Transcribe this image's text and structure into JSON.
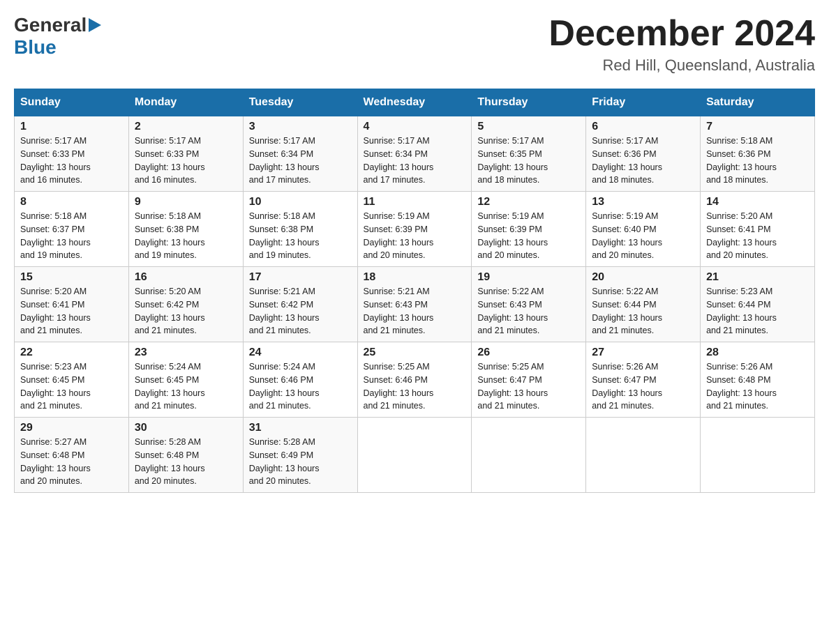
{
  "header": {
    "month_year": "December 2024",
    "location": "Red Hill, Queensland, Australia",
    "logo_general": "General",
    "logo_blue": "Blue"
  },
  "days_of_week": [
    "Sunday",
    "Monday",
    "Tuesday",
    "Wednesday",
    "Thursday",
    "Friday",
    "Saturday"
  ],
  "weeks": [
    [
      {
        "day": "1",
        "sunrise": "5:17 AM",
        "sunset": "6:33 PM",
        "daylight": "13 hours and 16 minutes."
      },
      {
        "day": "2",
        "sunrise": "5:17 AM",
        "sunset": "6:33 PM",
        "daylight": "13 hours and 16 minutes."
      },
      {
        "day": "3",
        "sunrise": "5:17 AM",
        "sunset": "6:34 PM",
        "daylight": "13 hours and 17 minutes."
      },
      {
        "day": "4",
        "sunrise": "5:17 AM",
        "sunset": "6:34 PM",
        "daylight": "13 hours and 17 minutes."
      },
      {
        "day": "5",
        "sunrise": "5:17 AM",
        "sunset": "6:35 PM",
        "daylight": "13 hours and 18 minutes."
      },
      {
        "day": "6",
        "sunrise": "5:17 AM",
        "sunset": "6:36 PM",
        "daylight": "13 hours and 18 minutes."
      },
      {
        "day": "7",
        "sunrise": "5:18 AM",
        "sunset": "6:36 PM",
        "daylight": "13 hours and 18 minutes."
      }
    ],
    [
      {
        "day": "8",
        "sunrise": "5:18 AM",
        "sunset": "6:37 PM",
        "daylight": "13 hours and 19 minutes."
      },
      {
        "day": "9",
        "sunrise": "5:18 AM",
        "sunset": "6:38 PM",
        "daylight": "13 hours and 19 minutes."
      },
      {
        "day": "10",
        "sunrise": "5:18 AM",
        "sunset": "6:38 PM",
        "daylight": "13 hours and 19 minutes."
      },
      {
        "day": "11",
        "sunrise": "5:19 AM",
        "sunset": "6:39 PM",
        "daylight": "13 hours and 20 minutes."
      },
      {
        "day": "12",
        "sunrise": "5:19 AM",
        "sunset": "6:39 PM",
        "daylight": "13 hours and 20 minutes."
      },
      {
        "day": "13",
        "sunrise": "5:19 AM",
        "sunset": "6:40 PM",
        "daylight": "13 hours and 20 minutes."
      },
      {
        "day": "14",
        "sunrise": "5:20 AM",
        "sunset": "6:41 PM",
        "daylight": "13 hours and 20 minutes."
      }
    ],
    [
      {
        "day": "15",
        "sunrise": "5:20 AM",
        "sunset": "6:41 PM",
        "daylight": "13 hours and 21 minutes."
      },
      {
        "day": "16",
        "sunrise": "5:20 AM",
        "sunset": "6:42 PM",
        "daylight": "13 hours and 21 minutes."
      },
      {
        "day": "17",
        "sunrise": "5:21 AM",
        "sunset": "6:42 PM",
        "daylight": "13 hours and 21 minutes."
      },
      {
        "day": "18",
        "sunrise": "5:21 AM",
        "sunset": "6:43 PM",
        "daylight": "13 hours and 21 minutes."
      },
      {
        "day": "19",
        "sunrise": "5:22 AM",
        "sunset": "6:43 PM",
        "daylight": "13 hours and 21 minutes."
      },
      {
        "day": "20",
        "sunrise": "5:22 AM",
        "sunset": "6:44 PM",
        "daylight": "13 hours and 21 minutes."
      },
      {
        "day": "21",
        "sunrise": "5:23 AM",
        "sunset": "6:44 PM",
        "daylight": "13 hours and 21 minutes."
      }
    ],
    [
      {
        "day": "22",
        "sunrise": "5:23 AM",
        "sunset": "6:45 PM",
        "daylight": "13 hours and 21 minutes."
      },
      {
        "day": "23",
        "sunrise": "5:24 AM",
        "sunset": "6:45 PM",
        "daylight": "13 hours and 21 minutes."
      },
      {
        "day": "24",
        "sunrise": "5:24 AM",
        "sunset": "6:46 PM",
        "daylight": "13 hours and 21 minutes."
      },
      {
        "day": "25",
        "sunrise": "5:25 AM",
        "sunset": "6:46 PM",
        "daylight": "13 hours and 21 minutes."
      },
      {
        "day": "26",
        "sunrise": "5:25 AM",
        "sunset": "6:47 PM",
        "daylight": "13 hours and 21 minutes."
      },
      {
        "day": "27",
        "sunrise": "5:26 AM",
        "sunset": "6:47 PM",
        "daylight": "13 hours and 21 minutes."
      },
      {
        "day": "28",
        "sunrise": "5:26 AM",
        "sunset": "6:48 PM",
        "daylight": "13 hours and 21 minutes."
      }
    ],
    [
      {
        "day": "29",
        "sunrise": "5:27 AM",
        "sunset": "6:48 PM",
        "daylight": "13 hours and 20 minutes."
      },
      {
        "day": "30",
        "sunrise": "5:28 AM",
        "sunset": "6:48 PM",
        "daylight": "13 hours and 20 minutes."
      },
      {
        "day": "31",
        "sunrise": "5:28 AM",
        "sunset": "6:49 PM",
        "daylight": "13 hours and 20 minutes."
      },
      null,
      null,
      null,
      null
    ]
  ],
  "labels": {
    "sunrise": "Sunrise:",
    "sunset": "Sunset:",
    "daylight": "Daylight:"
  }
}
